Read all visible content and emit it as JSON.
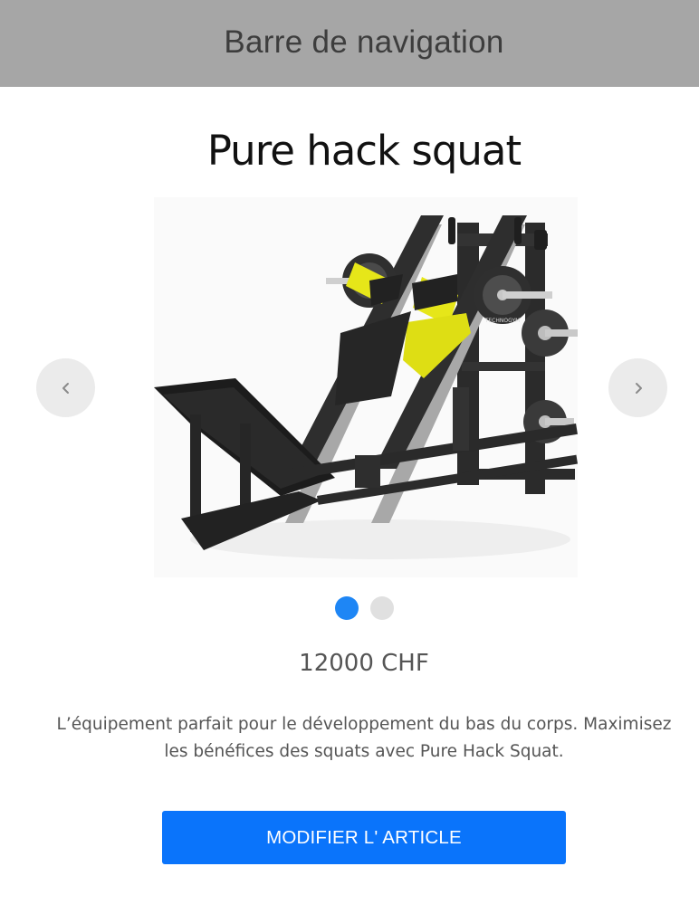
{
  "navbar": {
    "title": "Barre de navigation"
  },
  "product": {
    "title": "Pure hack squat",
    "price": "12000 CHF",
    "description": "L’équipement parfait pour le développement du bas du corps. Maximisez les bénéfices des squats avec Pure Hack Squat.",
    "image_alt": "Pure hack squat",
    "plate_text": "TECHNOGYM"
  },
  "carousel": {
    "prev_icon": "chevron-left-icon",
    "next_icon": "chevron-right-icon",
    "slide_count": 2,
    "active_slide": 1
  },
  "actions": {
    "edit_label": "MODIFIER L' ARTICLE"
  },
  "colors": {
    "navbar_bg": "#a6a6a6",
    "accent": "#0a74fb",
    "dot_active": "#1e86f5",
    "dot_inactive": "#e0e0e0",
    "machine_accent": "#e6e619"
  }
}
